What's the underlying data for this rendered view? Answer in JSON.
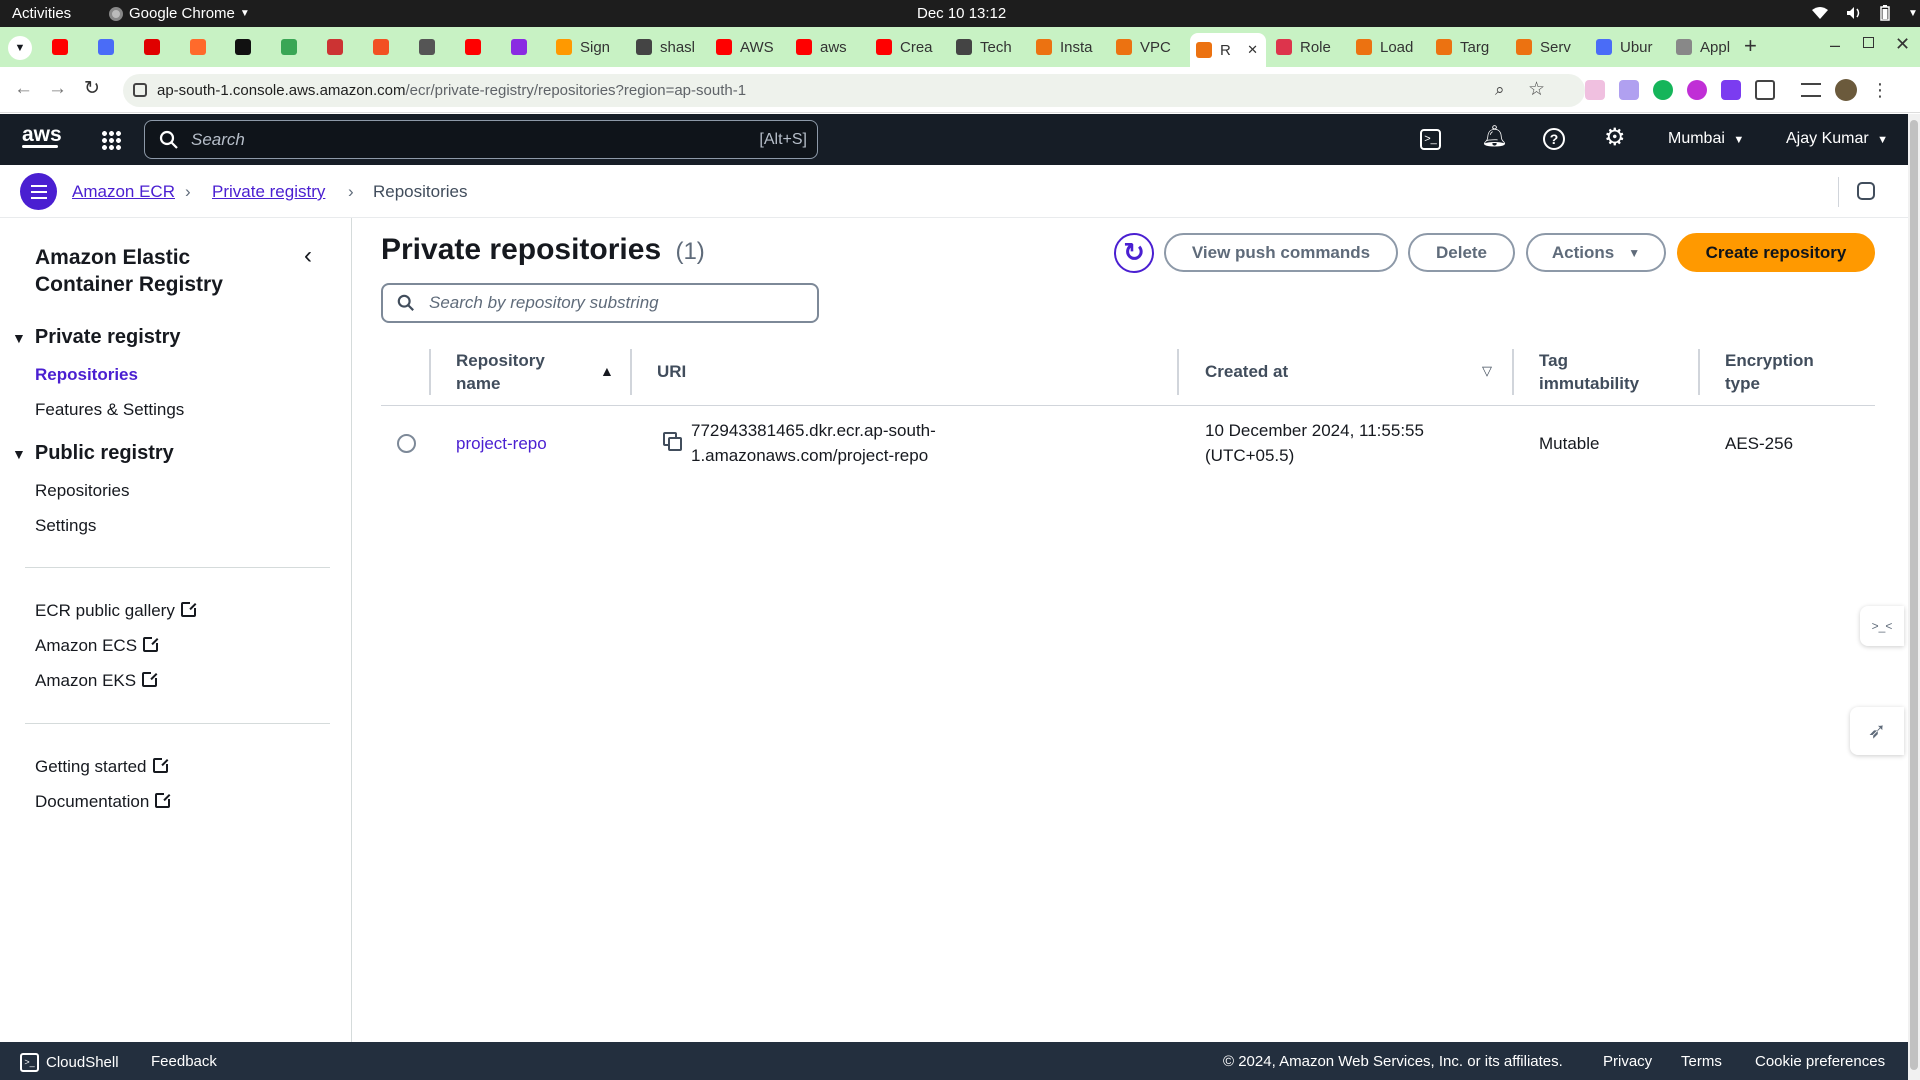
{
  "os": {
    "activities": "Activities",
    "app": "Google Chrome",
    "clock": "Dec 10  13:12"
  },
  "browser": {
    "tabs": [
      {
        "label": "",
        "color": "#ff0000"
      },
      {
        "label": "",
        "color": "#4a6cf7"
      },
      {
        "label": "",
        "color": "#e00000"
      },
      {
        "label": "",
        "color": "#ff6a2b"
      },
      {
        "label": "",
        "color": "#111111"
      },
      {
        "label": "",
        "color": "#3aa655"
      },
      {
        "label": "",
        "color": "#cc3333"
      },
      {
        "label": "",
        "color": "#f25022"
      },
      {
        "label": "",
        "color": "#555555"
      },
      {
        "label": "",
        "color": "#ff0000"
      },
      {
        "label": "",
        "color": "#8a2be2"
      },
      {
        "label": "Sign",
        "color": "#ff9900"
      },
      {
        "label": "shasl",
        "color": "#444444"
      },
      {
        "label": "AWS",
        "color": "#ff0000"
      },
      {
        "label": "aws",
        "color": "#ff0000"
      },
      {
        "label": "Crea",
        "color": "#ff0000"
      },
      {
        "label": "Tech",
        "color": "#444444"
      },
      {
        "label": "Insta",
        "color": "#ec7211"
      },
      {
        "label": "VPC",
        "color": "#ec7211"
      },
      {
        "label": "R",
        "color": "#ec7211"
      },
      {
        "label": "Role",
        "color": "#dd344c"
      },
      {
        "label": "Load",
        "color": "#ec7211"
      },
      {
        "label": "Targ",
        "color": "#ec7211"
      },
      {
        "label": "Serv",
        "color": "#ec7211"
      },
      {
        "label": "Ubur",
        "color": "#4a6cf7"
      },
      {
        "label": "Appl",
        "color": "#888888"
      }
    ],
    "url_host": "ap-south-1.console.aws.amazon.com",
    "url_path": "/ecr/private-registry/repositories?region=ap-south-1"
  },
  "aws_header": {
    "search_placeholder": "Search",
    "search_shortcut": "[Alt+S]",
    "region": "Mumbai",
    "user": "Ajay Kumar"
  },
  "breadcrumb": {
    "items": [
      "Amazon ECR",
      "Private registry",
      "Repositories"
    ]
  },
  "sidebar": {
    "title_line1": "Amazon Elastic",
    "title_line2": "Container Registry",
    "private_registry": "Private registry",
    "private_items": [
      "Repositories",
      "Features & Settings"
    ],
    "public_registry": "Public registry",
    "public_items": [
      "Repositories",
      "Settings"
    ],
    "links1": [
      "ECR public gallery",
      "Amazon ECS",
      "Amazon EKS"
    ],
    "links2": [
      "Getting started",
      "Documentation"
    ]
  },
  "main": {
    "title": "Private repositories",
    "count": "(1)",
    "buttons": {
      "view_push": "View push commands",
      "delete": "Delete",
      "actions": "Actions",
      "create": "Create repository"
    },
    "search_placeholder": "Search by repository substring",
    "columns": {
      "name1": "Repository",
      "name2": "name",
      "uri": "URI",
      "created": "Created at",
      "tag1": "Tag",
      "tag2": "immutability",
      "enc1": "Encryption",
      "enc2": "type"
    },
    "rows": [
      {
        "name": "project-repo",
        "uri1": "772943381465.dkr.ecr.ap-south-",
        "uri2": "1.amazonaws.com/project-repo",
        "created1": "10 December 2024, 11:55:55",
        "created2": "(UTC+05.5)",
        "tag": "Mutable",
        "encryption": "AES-256"
      }
    ]
  },
  "footer": {
    "cloudshell": "CloudShell",
    "feedback": "Feedback",
    "copyright": "© 2024, Amazon Web Services, Inc. or its affiliates.",
    "privacy": "Privacy",
    "terms": "Terms",
    "cookies": "Cookie preferences"
  },
  "colors": {
    "link": "#4a1fd1",
    "primary": "#ff9900",
    "header": "#161d26",
    "footer": "#232f3e",
    "tabstrip": "#c8f2c4"
  }
}
